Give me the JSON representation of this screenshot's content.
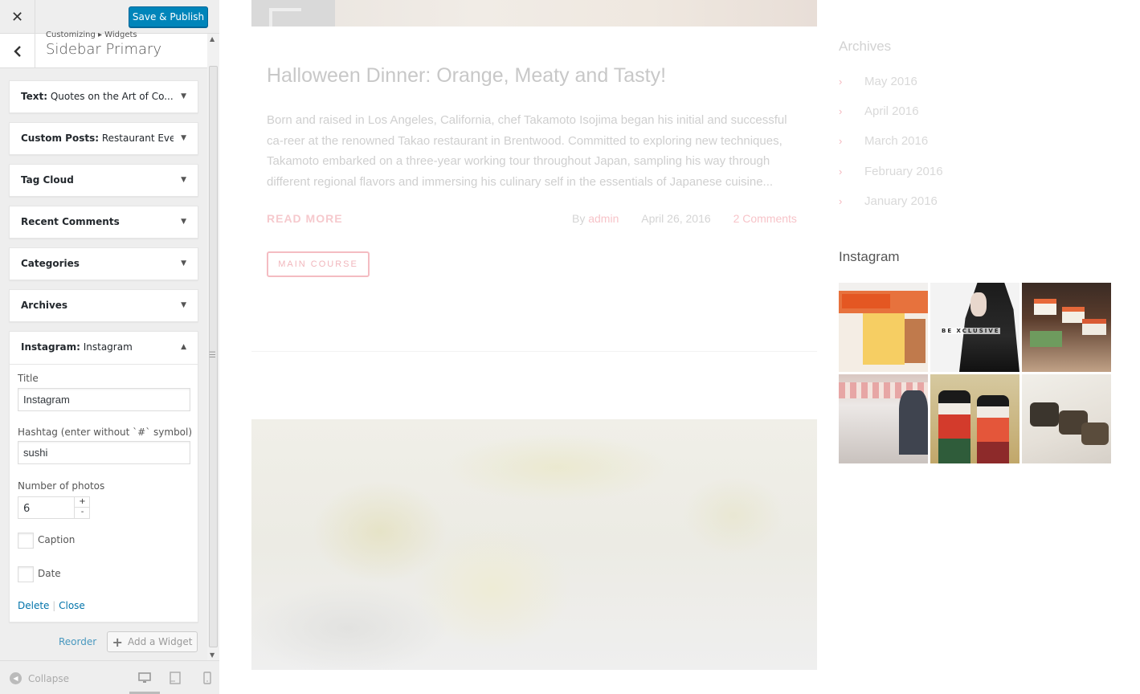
{
  "customizer": {
    "save_label": "Save & Publish",
    "breadcrumb": "Customizing ▸ Widgets",
    "section_title": "Sidebar Primary",
    "widgets": [
      {
        "type": "Text:",
        "title": " Quotes on the Art of Co..."
      },
      {
        "type": "Custom Posts:",
        "title": " Restaurant Eve..."
      },
      {
        "type": "Tag Cloud",
        "title": ""
      },
      {
        "type": "Recent Comments",
        "title": ""
      },
      {
        "type": "Categories",
        "title": ""
      },
      {
        "type": "Archives",
        "title": ""
      },
      {
        "type": "Instagram:",
        "title": " Instagram"
      }
    ],
    "instagram_form": {
      "title_label": "Title",
      "title_value": "Instagram",
      "hashtag_label": "Hashtag (enter without `#` symbol)",
      "hashtag_value": "sushi",
      "photos_label": "Number of photos",
      "photos_value": "6",
      "caption_label": "Caption",
      "date_label": "Date",
      "delete_label": "Delete",
      "close_label": "Close",
      "separator": " | "
    },
    "reorder_label": "Reorder",
    "add_widget_label": "Add a Widget",
    "collapse_label": "Collapse"
  },
  "preview": {
    "post": {
      "title": "Halloween Dinner: Orange, Meaty and Tasty!",
      "excerpt": "Born and raised in Los Angeles, California, chef Takamoto Isojima began his initial and successful ca-reer at the renowned Takao restaurant in Brentwood. Committed to exploring new techniques, Takamoto embarked on a three-year working tour throughout Japan, sampling his way through different regional flavors and immersing his culinary self in the essentials of Japanese cuisine...",
      "read_more": "READ MORE",
      "by": "By ",
      "author": "admin",
      "date": "April 26, 2016",
      "comments": "2 Comments",
      "category": "MAIN COURSE"
    },
    "archives": {
      "title": "Archives",
      "items": [
        "May 2016",
        "April 2016",
        "March 2016",
        "February 2016",
        "January 2016"
      ]
    },
    "instagram": {
      "title": "Instagram",
      "photo_2_text": "BE XCLUSIVE"
    }
  },
  "colors": {
    "primary_button": "#0085ba",
    "link": "#0073aa",
    "accent_pink": "#f5b7be"
  }
}
